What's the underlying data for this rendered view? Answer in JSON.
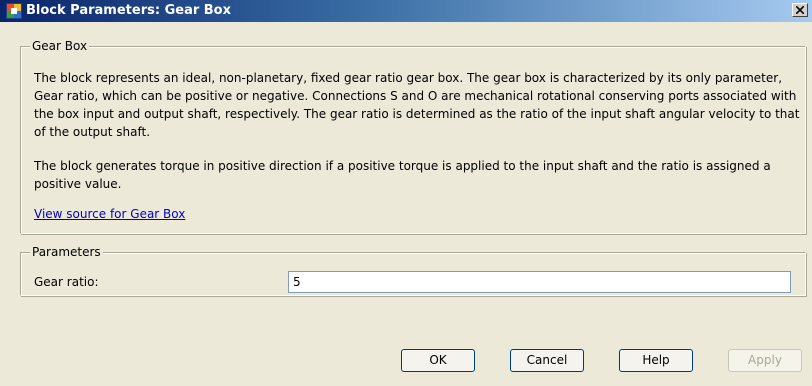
{
  "window": {
    "title": "Block Parameters: Gear Box",
    "close_symbol": "X"
  },
  "description_group": {
    "legend": "Gear Box",
    "paragraph1": "The block represents an ideal, non-planetary, fixed gear ratio gear box. The gear box is characterized by its only parameter, Gear ratio, which can be positive or negative. Connections S and O are mechanical rotational conserving ports associated with the box input and output shaft, respectively. The gear ratio is determined as the ratio of the input shaft angular velocity to that of the output shaft.",
    "paragraph2": "The block generates torque in positive direction if a positive torque is applied to the input shaft and the ratio is assigned a positive value.",
    "source_link": "View source for Gear Box"
  },
  "parameters_group": {
    "legend": "Parameters",
    "fields": [
      {
        "label": "Gear ratio:",
        "value": "5"
      }
    ]
  },
  "buttons": {
    "ok": "OK",
    "cancel": "Cancel",
    "help": "Help",
    "apply": "Apply",
    "apply_disabled": true
  },
  "colors": {
    "titlebar_start": "#0a246a",
    "titlebar_end": "#a6caf0",
    "dialog_background": "#ece9d8",
    "link": "#0000cc"
  },
  "icons": {
    "app": "simulink-block-icon",
    "close": "close-icon"
  }
}
